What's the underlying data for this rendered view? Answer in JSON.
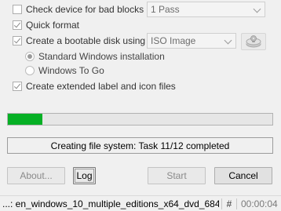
{
  "options": {
    "bad_blocks": {
      "label": "Check device for bad blocks",
      "checked": false,
      "passes": "1 Pass"
    },
    "quick_format": {
      "label": "Quick format",
      "checked": true
    },
    "bootable": {
      "label": "Create a bootable disk using",
      "checked": true,
      "source": "ISO Image"
    },
    "standard_windows": {
      "label": "Standard Windows installation",
      "selected": true
    },
    "windows_to_go": {
      "label": "Windows To Go",
      "selected": false
    },
    "extended_label": {
      "label": "Create extended label and icon files",
      "checked": true
    }
  },
  "icons": {
    "disk_button": "optical-disk-icon"
  },
  "progress": {
    "fraction": 0.13,
    "color": "#06b025"
  },
  "status": {
    "text": "Creating file system: Task 11/12 completed"
  },
  "buttons": {
    "about": "About...",
    "log": "Log",
    "start": "Start",
    "cancel": "Cancel"
  },
  "statusbar": {
    "file": "...: en_windows_10_multiple_editions_x64_dvd_684...",
    "hash": "#",
    "elapsed": "00:00:04"
  }
}
